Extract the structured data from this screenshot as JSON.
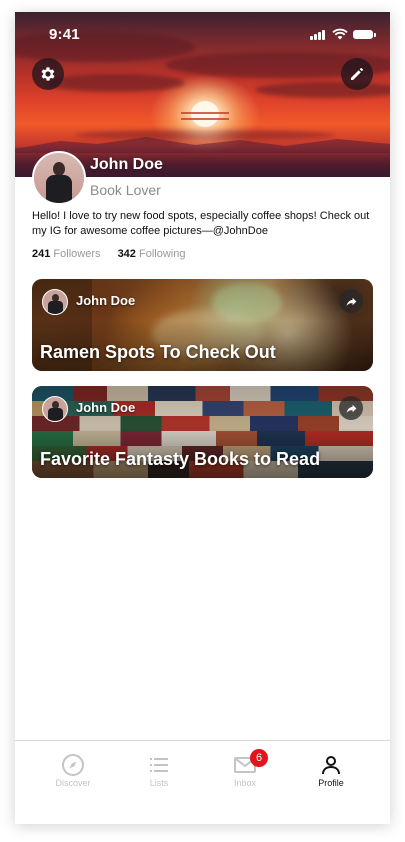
{
  "status_bar": {
    "time": "9:41"
  },
  "header": {
    "settings_icon": "gear-icon",
    "edit_icon": "pencil-icon"
  },
  "profile": {
    "name": "John Doe",
    "role": "Book Lover",
    "bio": "Hello! I love to try new food spots, especially coffee shops! Check out my IG for awesome coffee pictures—@JohnDoe",
    "followers_count": "241",
    "followers_label": "Followers",
    "following_count": "342",
    "following_label": "Following"
  },
  "lists": [
    {
      "author": "John Doe",
      "title": "Ramen Spots To Check Out",
      "share_icon": "share-icon"
    },
    {
      "author": "John Doe",
      "title": "Favorite Fantasty Books to Read",
      "share_icon": "share-icon"
    }
  ],
  "tabbar": {
    "items": [
      {
        "label": "Discover",
        "icon": "compass-icon",
        "active": false
      },
      {
        "label": "Lists",
        "icon": "list-icon",
        "active": false
      },
      {
        "label": "Inbox",
        "icon": "mail-icon",
        "active": false,
        "badge": "6"
      },
      {
        "label": "Profile",
        "icon": "person-icon",
        "active": true
      }
    ]
  },
  "colors": {
    "badge": "#e3141c",
    "inactive_tab": "#c4c4c4",
    "active_tab": "#111111",
    "secondary_text": "#8a8a8a"
  }
}
